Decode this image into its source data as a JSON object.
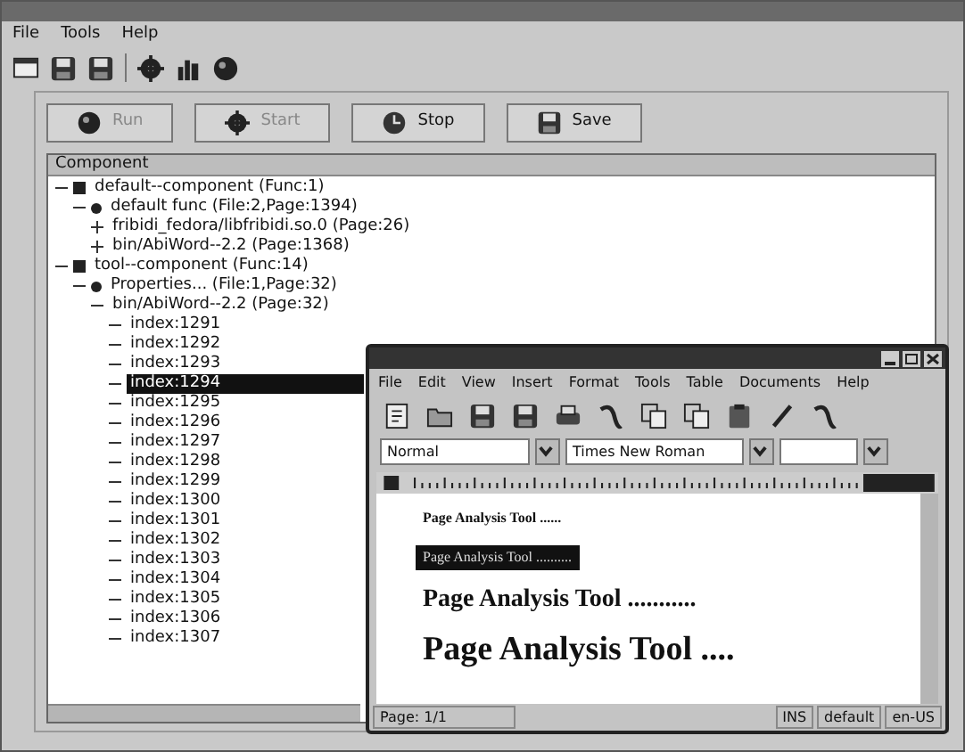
{
  "main_window": {
    "menu": [
      "File",
      "Tools",
      "Help"
    ],
    "buttons": [
      {
        "label": "Run",
        "disabled": true
      },
      {
        "label": "Start",
        "disabled": true
      },
      {
        "label": "Stop",
        "disabled": false
      },
      {
        "label": "Save",
        "disabled": false
      }
    ],
    "tree": {
      "header": "Component",
      "items": [
        {
          "text": "default--component (Func:1)",
          "kind": "component",
          "expanded": true,
          "selected": false,
          "children": [
            {
              "text": "default func (File:2,Page:1394)",
              "kind": "function",
              "expanded": true,
              "selected": false,
              "children": [
                {
                  "text": "fribidi_fedora/libfribidi.so.0 (Page:26)",
                  "expanded": false,
                  "selected": false
                },
                {
                  "text": "bin/AbiWord--2.2 (Page:1368)",
                  "expanded": false,
                  "selected": false
                }
              ]
            }
          ]
        },
        {
          "text": "tool--component (Func:14)",
          "kind": "component",
          "expanded": true,
          "selected": false,
          "children": [
            {
              "text": "Properties... (File:1,Page:32)",
              "kind": "function",
              "expanded": true,
              "selected": false,
              "children": [
                {
                  "text": "bin/AbiWord--2.2 (Page:32)",
                  "expanded": true,
                  "selected": false,
                  "children": [
                    {
                      "text": "index:1291",
                      "selected": false
                    },
                    {
                      "text": "index:1292",
                      "selected": false
                    },
                    {
                      "text": "index:1293",
                      "selected": false
                    },
                    {
                      "text": "index:1294",
                      "selected": true
                    },
                    {
                      "text": "index:1295",
                      "selected": false
                    },
                    {
                      "text": "index:1296",
                      "selected": false
                    },
                    {
                      "text": "index:1297",
                      "selected": false
                    },
                    {
                      "text": "index:1298",
                      "selected": false
                    },
                    {
                      "text": "index:1299",
                      "selected": false
                    },
                    {
                      "text": "index:1300",
                      "selected": false
                    },
                    {
                      "text": "index:1301",
                      "selected": false
                    },
                    {
                      "text": "index:1302",
                      "selected": false
                    },
                    {
                      "text": "index:1303",
                      "selected": false
                    },
                    {
                      "text": "index:1304",
                      "selected": false
                    },
                    {
                      "text": "index:1305",
                      "selected": false
                    },
                    {
                      "text": "index:1306",
                      "selected": false
                    },
                    {
                      "text": "index:1307",
                      "selected": false
                    }
                  ]
                }
              ]
            }
          ]
        }
      ]
    }
  },
  "editor_window": {
    "menu": [
      "File",
      "Edit",
      "View",
      "Insert",
      "Format",
      "Tools",
      "Table",
      "Documents",
      "Help"
    ],
    "style_field": "Normal",
    "font_field": "Times New Roman",
    "lines": [
      {
        "text": "Page Analysis Tool ......",
        "kind": "small",
        "selected": false
      },
      {
        "text": "Page Analysis Tool ..........",
        "kind": "small",
        "selected": true
      },
      {
        "text": "Page Analysis Tool ...........",
        "kind": "medium",
        "selected": false
      },
      {
        "text": "Page Analysis Tool ....",
        "kind": "large",
        "selected": false
      }
    ],
    "status_bar": [
      "Page: 1/1",
      "INS",
      "default",
      "en-US"
    ]
  }
}
